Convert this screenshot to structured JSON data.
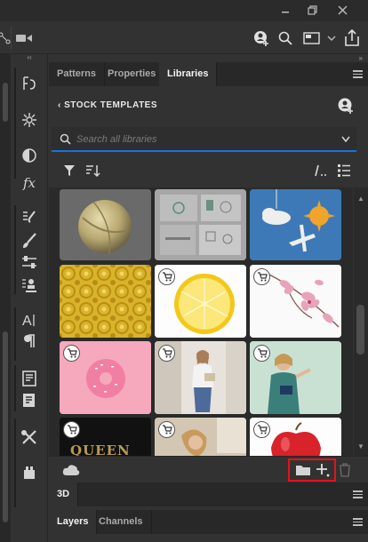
{
  "window": {
    "minimize_icon": "minimize-icon",
    "restore_icon": "restore-icon",
    "close_icon": "close-icon"
  },
  "options_bar": {
    "icons": [
      "transform-icon",
      "video-icon",
      "add-user-icon",
      "search-icon",
      "workspace-icon",
      "chevron-down-icon",
      "share-icon"
    ]
  },
  "tools": [
    "history-brush-icon",
    "color-wheel-icon",
    "adjustments-icon",
    "fx-icon",
    "brush-settings-icon",
    "brush-icon",
    "properties-sliders-icon",
    "clone-source-icon",
    "character-icon",
    "paragraph-icon",
    "notes-icon",
    "glyphs-icon",
    "tool-presets-icon",
    "plugins-icon"
  ],
  "tabs": {
    "items": [
      "Patterns",
      "Properties",
      "Libraries"
    ],
    "active": "Libraries"
  },
  "library": {
    "back_label": "STOCK TEMPLATES",
    "search_placeholder": "Search all libraries",
    "items": [
      {
        "label": "sphere-render",
        "cart": false
      },
      {
        "label": "brand-mockup",
        "cart": false
      },
      {
        "label": "sky-illustration",
        "cart": false
      },
      {
        "label": "yellow-pattern",
        "cart": false
      },
      {
        "label": "lemon-slice",
        "cart": true
      },
      {
        "label": "pink-flowers",
        "cart": true
      },
      {
        "label": "pink-donut",
        "cart": true
      },
      {
        "label": "woman-reading",
        "cart": true
      },
      {
        "label": "teacher-woman",
        "cart": true
      },
      {
        "label": "queen-text",
        "cart": true
      },
      {
        "label": "woman-outdoor",
        "cart": true
      },
      {
        "label": "red-apple",
        "cart": true
      }
    ]
  },
  "sections": {
    "three_d": "3D",
    "layers": "Layers",
    "channels": "Channels"
  },
  "colors": {
    "accent": "#1473e6",
    "highlight": "#e8101b"
  }
}
